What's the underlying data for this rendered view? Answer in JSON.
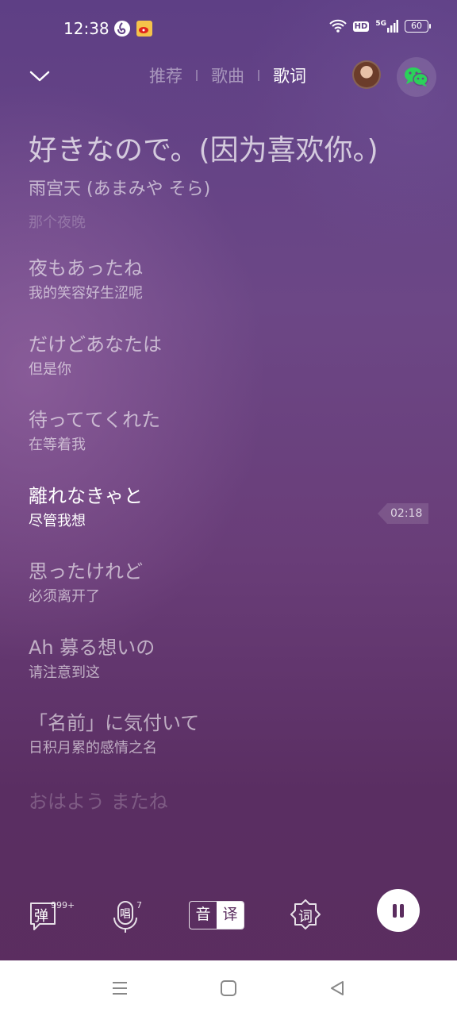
{
  "status": {
    "time": "12:38",
    "network": "5G",
    "hd": "HD",
    "battery": "60"
  },
  "header": {
    "tabs": [
      "推荐",
      "歌曲",
      "歌词"
    ],
    "active_tab": "歌词"
  },
  "song": {
    "title": "好きなので。(因为喜欢你。)",
    "artist": "雨宫天 (あまみや そら)"
  },
  "lyrics": {
    "faded_top": "那个夜晚",
    "lines": [
      {
        "orig": "夜もあったね",
        "trans": "我的笑容好生涩呢"
      },
      {
        "orig": "だけどあなたは",
        "trans": "但是你"
      },
      {
        "orig": "待っててくれた",
        "trans": "在等着我"
      },
      {
        "orig": "離れなきゃと",
        "trans": "尽管我想",
        "current": true
      },
      {
        "orig": "思ったけれど",
        "trans": "必须离开了"
      },
      {
        "orig": "Ah 募る想いの",
        "trans": "请注意到这"
      },
      {
        "orig": "「名前」に気付いて",
        "trans": "日积月累的感情之名"
      }
    ],
    "faded_bottom": "おはよう またね",
    "current_time": "02:18"
  },
  "controls": {
    "danmaku_label": "弹",
    "danmaku_count": "999+",
    "sing_label": "唱",
    "sing_count": "7",
    "toggle_phonetic": "音",
    "toggle_translate": "译",
    "lyric_label": "词"
  },
  "colors": {
    "accent": "#6c4786",
    "wechat_green": "#2bd15a"
  }
}
